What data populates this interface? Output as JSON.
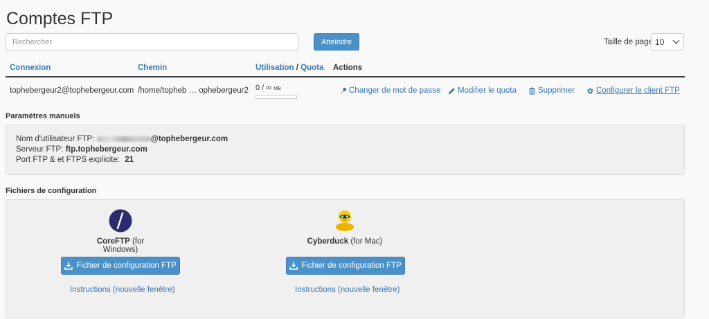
{
  "page": {
    "title": "Comptes FTP"
  },
  "search": {
    "placeholder": "Rechercher",
    "button_label": "Atteindre"
  },
  "pagination": {
    "label": "Taille de page",
    "selected": "10"
  },
  "table": {
    "headers": {
      "login": "Connexion",
      "path": "Chemin",
      "usage": "Utilisation",
      "slash": "/",
      "quota": "Quota",
      "actions": "Actions"
    },
    "rows": [
      {
        "login": "tophebergeur2@tophebergeur.com",
        "path": "/home/topheb … ophebergeur2",
        "usage": "0 / ∞",
        "usage_unit": "MB",
        "usage_fraction": 0,
        "actions": {
          "change_password": "Changer de mot de passe",
          "modify_quota": "Modifier le quota",
          "delete": "Supprimer",
          "configure_client": "Configurer le client FTP"
        }
      }
    ]
  },
  "manual": {
    "section_title": "Paramètres manuels",
    "username_label": "Nom d'utilisateur FTP:",
    "username_domain": "@tophebergeur.com",
    "server_label": "Serveur FTP:",
    "server_value": "ftp.tophebergeur.com",
    "port_label": "Port FTP & et FTPS explicite:",
    "port_value": "21"
  },
  "config": {
    "section_title": "Fichiers de configuration",
    "clients": [
      {
        "name": "CoreFTP",
        "platform": "(for Windows)",
        "button": "Fichier de configuration FTP",
        "link": "Instructions (nouvelle fenêtre)"
      },
      {
        "name": "Cyberduck",
        "platform": "(for Mac)",
        "button": "Fichier de configuration FTP",
        "link": "Instructions (nouvelle fenêtre)"
      }
    ]
  },
  "colors": {
    "link": "#3a78b5",
    "primary_button": "#4a90c9",
    "panel_bg": "#f0f0f0"
  }
}
